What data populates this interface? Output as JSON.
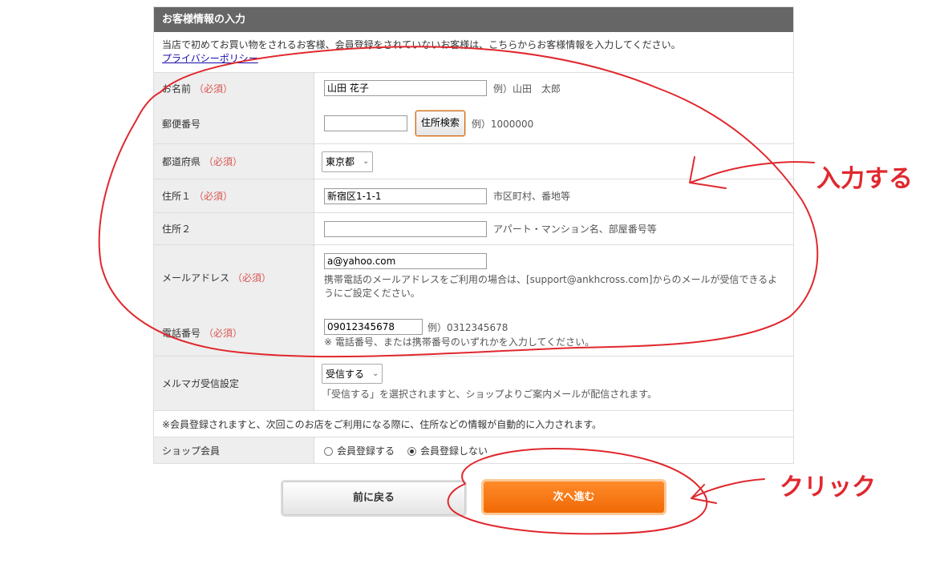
{
  "panel": {
    "title": "お客様情報の入力",
    "intro": "当店で初めてお買い物をされるお客様、会員登録をされていないお客様は、こちらからお客様情報を入力してください。",
    "privacy_link": "プライバシーポリシー"
  },
  "form": {
    "required": "（必須）",
    "name": {
      "label": "お名前",
      "value": "山田 花子",
      "example": "例）山田　太郎"
    },
    "zip": {
      "label": "郵便番号",
      "value": "",
      "button": "住所検索",
      "example": "例）1000000"
    },
    "pref": {
      "label": "都道府県",
      "value": "東京都"
    },
    "addr1": {
      "label": "住所１",
      "value": "新宿区1-1-1",
      "example": "市区町村、番地等"
    },
    "addr2": {
      "label": "住所２",
      "value": "",
      "example": "アパート・マンション名、部屋番号等"
    },
    "email": {
      "label": "メールアドレス",
      "value": "a@yahoo.com",
      "note": "携帯電話のメールアドレスをご利用の場合は、[support@ankhcross.com]からのメールが受信できるようにご設定ください。"
    },
    "tel": {
      "label": "電話番号",
      "value": "09012345678",
      "example": "例）0312345678",
      "note": "※ 電話番号、または携帯番号のいずれかを入力してください。"
    },
    "mailmag": {
      "label": "メルマガ受信設定",
      "value": "受信する",
      "note": "「受信する」を選択されますと、ショップよりご案内メールが配信されます。"
    },
    "member_note": "※会員登録されますと、次回このお店をご利用になる際に、住所などの情報が自動的に入力されます。",
    "shop_member": {
      "label": "ショップ会員",
      "option_yes": "会員登録する",
      "option_no": "会員登録しない",
      "selected": "会員登録しない"
    }
  },
  "buttons": {
    "back": "前に戻る",
    "next": "次へ進む"
  },
  "annotations": {
    "input": "入力する",
    "click": "クリック",
    "color": "#e0282e"
  },
  "icons": {
    "chevron": "chevron-down-icon",
    "radio": "radio-icon"
  }
}
